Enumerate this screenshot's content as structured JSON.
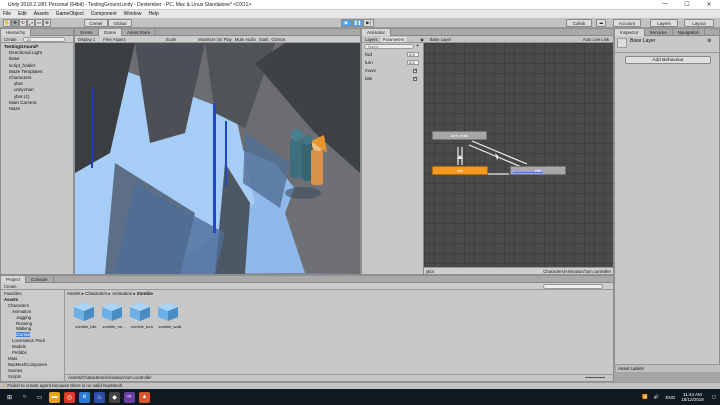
{
  "window": {
    "title": "Unity 2018.2.18f1 Personal (64bit) - TestingGround.unity - Dextember - PC, Mac & Linux Standalone* <DX11>",
    "controls": [
      "—",
      "☐",
      "✕"
    ]
  },
  "menu": [
    "File",
    "Edit",
    "Assets",
    "GameObject",
    "Component",
    "Window",
    "Help"
  ],
  "toolbar": {
    "pivot_label": "Center",
    "space_label": "Global",
    "collab_label": "Collab",
    "account_label": "Account",
    "layers_label": "Layers",
    "layout_label": "Layout"
  },
  "hierarchy": {
    "tab": "Hierarchy",
    "create_label": "Create",
    "search_placeholder": "All",
    "items": [
      {
        "label": "TestingGround*",
        "depth": 0,
        "bold": true
      },
      {
        "label": "Directional Light",
        "depth": 1
      },
      {
        "label": "Base",
        "depth": 1
      },
      {
        "label": "script_holder",
        "depth": 1
      },
      {
        "label": "Maze Templates",
        "depth": 1
      },
      {
        "label": "Characters",
        "depth": 1
      },
      {
        "label": "ybot",
        "depth": 2
      },
      {
        "label": "unitychan",
        "depth": 2
      },
      {
        "label": "ybot (1)",
        "depth": 2
      },
      {
        "label": "Main Camera",
        "depth": 1
      },
      {
        "label": "Maze",
        "depth": 1
      }
    ]
  },
  "scene_tabs": [
    {
      "label": "Scene",
      "active": false
    },
    {
      "label": "Game",
      "active": true
    },
    {
      "label": "Asset Store",
      "active": false
    }
  ],
  "game_bar": {
    "display": "Display 1",
    "aspect": "Free Aspect",
    "scale_label": "Scale",
    "toggles": [
      "Maximize On Play",
      "Mute Audio",
      "Stats",
      "Gizmos"
    ]
  },
  "animator": {
    "tab": "Animator",
    "subtabs": [
      "Layers",
      "Parameters"
    ],
    "breadcrumb": "Base Layer",
    "auto_live_link": "Auto Live Link",
    "search_placeholder": "Name",
    "parameters": [
      {
        "name": "fwd",
        "type": "float",
        "value": "0.0"
      },
      {
        "name": "turn",
        "type": "float",
        "value": "0.0"
      },
      {
        "name": "move",
        "type": "bool",
        "value": true
      },
      {
        "name": "bite",
        "type": "bool",
        "value": true
      }
    ],
    "states": [
      {
        "label": "turn_walk",
        "kind": "default_gray"
      },
      {
        "label": "idle",
        "kind": "entry_orange"
      },
      {
        "label": "bite",
        "kind": "active_gray"
      }
    ],
    "footer_left": "ybot",
    "footer_right": "Characters/Animation/zom.controller"
  },
  "inspector": {
    "tabs": [
      "Inspector",
      "Services",
      "Navigation"
    ],
    "layer_name": "Base Layer",
    "add_behaviour": "Add Behaviour",
    "asset_labels": "Asset Labels"
  },
  "project": {
    "tabs": [
      "Project",
      "Console"
    ],
    "create_label": "Create",
    "breadcrumb": [
      "Assets",
      "Characters",
      "Animation",
      "Zombie"
    ],
    "tree": [
      {
        "label": "Favorites",
        "depth": 0
      },
      {
        "label": "Assets",
        "depth": 0,
        "bold": true
      },
      {
        "label": "Characters",
        "depth": 1
      },
      {
        "label": "Animation",
        "depth": 2
      },
      {
        "label": "Jogging",
        "depth": 3
      },
      {
        "label": "Running",
        "depth": 3
      },
      {
        "label": "Walking",
        "depth": 3
      },
      {
        "label": "Zombie",
        "depth": 3
      },
      {
        "label": "Locomotion Pack",
        "depth": 2
      },
      {
        "label": "Models",
        "depth": 2
      },
      {
        "label": "Prefabs",
        "depth": 2
      },
      {
        "label": "Mats",
        "depth": 1
      },
      {
        "label": "NavMeshComponen",
        "depth": 1
      },
      {
        "label": "Scenes",
        "depth": 1
      },
      {
        "label": "Scripts",
        "depth": 1
      }
    ],
    "assets": [
      "zombie_idle",
      "zombie_ne...",
      "zombie_turn",
      "zombie_walk"
    ],
    "footer_path": "Assets/Characters/Animation/zom.controller"
  },
  "status": {
    "message": "Failed to create agent because there is no valid NavMesh"
  },
  "taskbar": {
    "lang": "ENG",
    "time": "11:44 AM",
    "date": "18/12/2018"
  },
  "colors": {
    "unity_gray": "#c8c8c8",
    "state_orange": "#f39a1e",
    "state_gray": "#a8a8a8",
    "grid_dark": "#4a4a4a",
    "play_blue": "#5aa0e6"
  }
}
